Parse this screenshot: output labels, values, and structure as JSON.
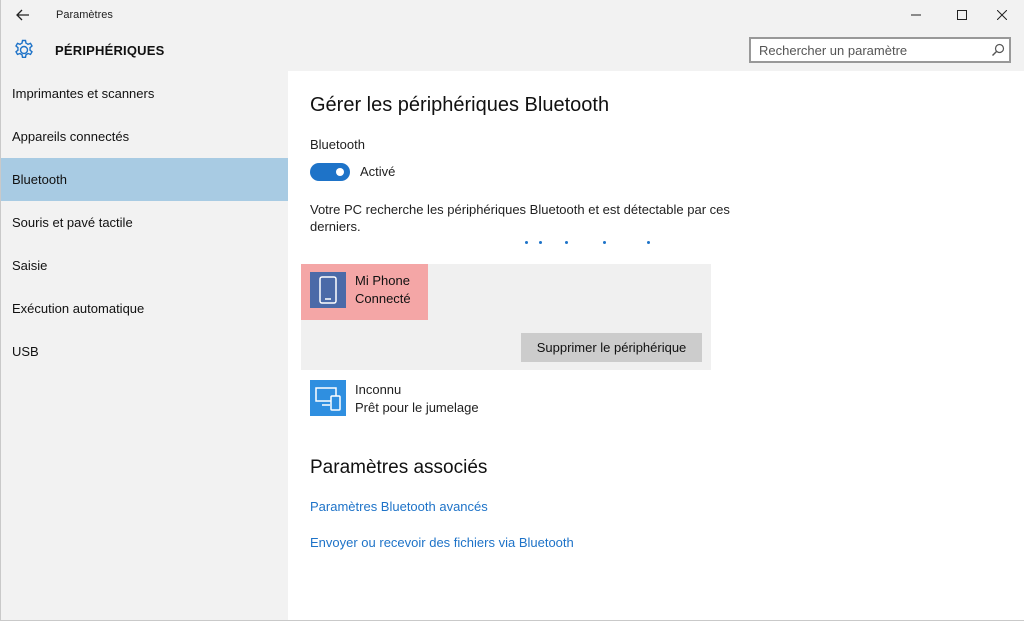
{
  "window": {
    "title": "Paramètres"
  },
  "header": {
    "section_title": "PÉRIPHÉRIQUES",
    "search_placeholder": "Rechercher un paramètre"
  },
  "sidebar": {
    "active_index": 2,
    "items": [
      {
        "label": "Imprimantes et scanners"
      },
      {
        "label": "Appareils connectés"
      },
      {
        "label": "Bluetooth"
      },
      {
        "label": "Souris et pavé tactile"
      },
      {
        "label": "Saisie"
      },
      {
        "label": "Exécution automatique"
      },
      {
        "label": "USB"
      }
    ]
  },
  "main": {
    "heading": "Gérer les périphériques Bluetooth",
    "bluetooth_label": "Bluetooth",
    "toggle_state": "Activé",
    "description": "Votre PC recherche les périphériques Bluetooth et est détectable par ces derniers.",
    "devices": [
      {
        "name": "Mi Phone",
        "status": "Connecté",
        "icon": "phone-icon",
        "selected": true,
        "action_label": "Supprimer le périphérique"
      },
      {
        "name": "Inconnu",
        "status": "Prêt pour le jumelage",
        "icon": "devices-icon"
      }
    ],
    "related_title": "Paramètres associés",
    "links": [
      {
        "label": "Paramètres Bluetooth avancés"
      },
      {
        "label": "Envoyer ou recevoir des fichiers via Bluetooth"
      }
    ]
  },
  "colors": {
    "accent": "#1e73c8",
    "selected_sidebar": "#a8cbe3",
    "device_highlight": "#f4a6a6",
    "phone_tile": "#4b6aa8",
    "unknown_tile": "#2f8fe0"
  }
}
